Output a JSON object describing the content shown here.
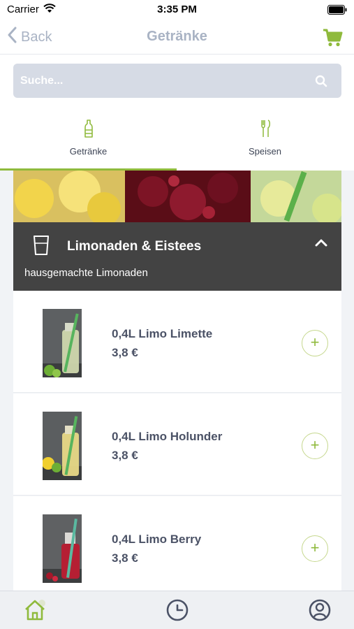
{
  "status_bar": {
    "carrier": "Carrier",
    "time": "3:35 PM"
  },
  "nav": {
    "back_label": "Back",
    "title": "Getränke"
  },
  "search": {
    "placeholder": "Suche..."
  },
  "tabs": [
    {
      "label": "Getränke",
      "icon": "bottle-icon",
      "active": true
    },
    {
      "label": "Speisen",
      "icon": "cutlery-icon",
      "active": false
    }
  ],
  "category": {
    "title": "Limonaden & Eistees",
    "subtitle": "hausgemachte Limonaden",
    "icon": "glass-icon",
    "expanded": true
  },
  "products": [
    {
      "name": "0,4L Limo Limette",
      "price": "3,8 €",
      "drink_color": "#c8d49a",
      "garnish": "lime"
    },
    {
      "name": "0,4L Limo Holunder",
      "price": "3,8 €",
      "drink_color": "#e6d37a",
      "garnish": "lemon"
    },
    {
      "name": "0,4L Limo Berry",
      "price": "3,8 €",
      "drink_color": "#b51f33",
      "garnish": "berry"
    }
  ],
  "add_label": "+",
  "bottom_tabs": [
    {
      "icon": "home-icon",
      "active": true
    },
    {
      "icon": "history-icon",
      "active": false
    },
    {
      "icon": "profile-icon",
      "active": false
    }
  ],
  "colors": {
    "accent": "#8fba3c",
    "nav_text": "#a9b3c4",
    "category_bg": "#434343",
    "text_dark": "#4b5266"
  }
}
